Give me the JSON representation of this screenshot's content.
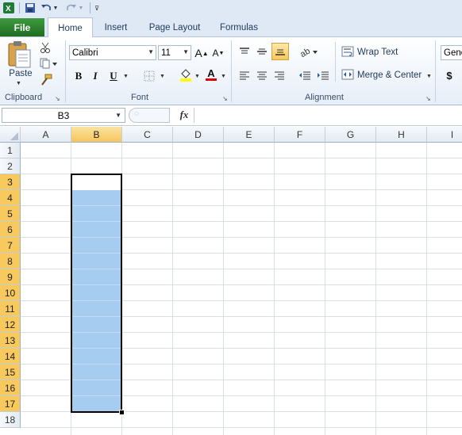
{
  "qat": {
    "app_icon": "excel-icon",
    "items": [
      "save-icon",
      "undo-icon",
      "redo-icon",
      "customize-qat-icon"
    ]
  },
  "tabs": {
    "file": "File",
    "items": [
      "Home",
      "Insert",
      "Page Layout",
      "Formulas"
    ]
  },
  "ribbon": {
    "clipboard": {
      "paste": "Paste",
      "label": "Clipboard"
    },
    "font": {
      "name": "Calibri",
      "size": "11",
      "label": "Font",
      "bold": "B",
      "italic": "I",
      "underline": "U",
      "grow": "A",
      "shrink": "A",
      "color_letter": "A"
    },
    "alignment": {
      "wrap": "Wrap Text",
      "merge": "Merge & Center",
      "label": "Alignment"
    },
    "number": {
      "format": "Gene",
      "currency": "$"
    }
  },
  "formula_bar": {
    "name_box": "B3",
    "fx": "fx",
    "value": ""
  },
  "grid": {
    "columns": [
      "A",
      "B",
      "C",
      "D",
      "E",
      "F",
      "G",
      "H",
      "I"
    ],
    "rows": [
      "1",
      "2",
      "3",
      "4",
      "5",
      "6",
      "7",
      "8",
      "9",
      "10",
      "11",
      "12",
      "13",
      "14",
      "15",
      "16",
      "17",
      "18"
    ],
    "selected_column": "B",
    "selection": "B3:B17",
    "active_cell": "B3"
  },
  "colors": {
    "selection_fill": "#a6ccef",
    "file_tab": "#2a7d2e",
    "header_highlight": "#f6c55c"
  }
}
